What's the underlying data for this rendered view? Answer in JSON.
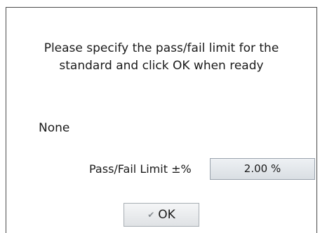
{
  "dialog": {
    "prompt_line1": "Please specify the pass/fail limit for the",
    "prompt_line2": "standard and click OK when ready",
    "standard_name": "None",
    "limit_label": "Pass/Fail Limit ±%",
    "limit_value": "2.00 %",
    "ok_label": "OK",
    "ok_icon": "checkmark-icon",
    "ok_icon_glyph": "✔"
  }
}
